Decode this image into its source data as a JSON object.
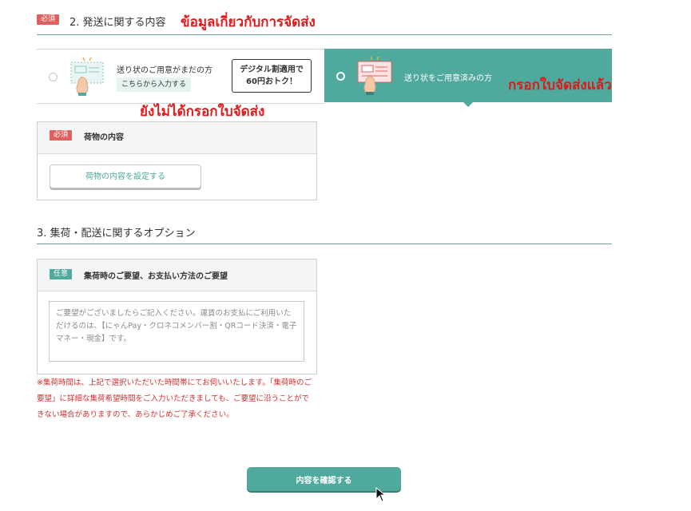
{
  "section2": {
    "badge": "必須",
    "title": "2. 発送に関する内容",
    "annotation": "ข้อมูลเกี่ยวกับการจัดส่ง"
  },
  "options": {
    "left": {
      "label": "送り状のご用意がまだの方",
      "chip": "こちらから入力する",
      "promo_line1": "デジタル割適用で",
      "promo_line2": "60円おトク！",
      "selected": false
    },
    "right": {
      "label": "送り状をご用意済みの方",
      "selected": true
    },
    "annotation_left": "ยังไม่ได้กรอกใบจัดส่ง",
    "annotation_right": "กรอกใบจัดส่งแล้ว"
  },
  "contents_box": {
    "badge": "必須",
    "title": "荷物の内容",
    "button": "荷物の内容を設定する"
  },
  "section3": {
    "title": "3. 集荷・配送に関するオプション"
  },
  "request_box": {
    "badge": "任意",
    "title": "集荷時のご要望、お支払い方法のご要望",
    "placeholder": "ご要望がございましたらご記入ください。運賃のお支払にご利用いただけるのは、【にゃんPay・クロネコメンバー割・QRコード決済・電子マネー・現金】です。",
    "note": "※集荷時間は、上記で選択いただいた時間帯にてお伺いいたします。「集荷時のご要望」に詳細な集荷希望時間をご入力いただきましても、ご要望に沿うことができない場合がありますので、あらかじめご了承ください。"
  },
  "confirm_button": "内容を確認する",
  "colors": {
    "accent": "#4fa99c",
    "required": "#e0605f",
    "annotation": "#e0191b",
    "note": "#d22f2f"
  }
}
